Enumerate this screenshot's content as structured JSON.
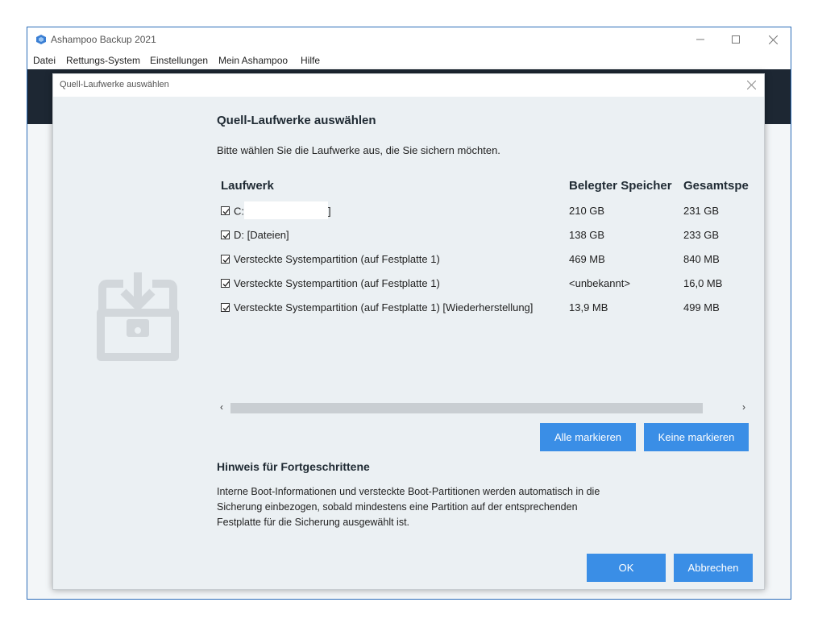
{
  "app": {
    "title": "Ashampoo Backup 2021"
  },
  "menu": [
    "Datei",
    "Rettungs-System",
    "Einstellungen",
    "Mein Ashampoo",
    "Hilfe"
  ],
  "dialog": {
    "window_title": "Quell-Laufwerke auswählen",
    "heading": "Quell-Laufwerke auswählen",
    "intro": "Bitte wählen Sie die Laufwerke aus, die Sie sichern möchten.",
    "columns": {
      "drive": "Laufwerk",
      "used": "Belegter Speicher",
      "total": "Gesamtspe"
    },
    "drives": [
      {
        "name_prefix": "C:",
        "name_suffix": "]",
        "used": "210 GB",
        "total": "231 GB",
        "checked": true
      },
      {
        "name": "D: [Dateien]",
        "used": "138 GB",
        "total": "233 GB",
        "checked": true
      },
      {
        "name": "Versteckte Systempartition (auf Festplatte 1)",
        "used": "469 MB",
        "total": "840 MB",
        "checked": true
      },
      {
        "name": "Versteckte Systempartition (auf Festplatte 1)",
        "used": "<unbekannt>",
        "total": "16,0 MB",
        "checked": true
      },
      {
        "name": "Versteckte Systempartition (auf Festplatte 1) [Wiederherstellung]",
        "used": "13,9 MB",
        "total": "499 MB",
        "checked": true
      }
    ],
    "buttons": {
      "select_all": "Alle markieren",
      "select_none": "Keine markieren",
      "ok": "OK",
      "cancel": "Abbrechen"
    },
    "hint": {
      "heading": "Hinweis für Fortgeschrittene",
      "text": "Interne Boot-Informationen und versteckte Boot-Partitionen werden automatisch in die Sicherung einbezogen, sobald mindestens eine Partition auf der entsprechenden Festplatte für die Sicherung ausgewählt ist."
    }
  },
  "colors": {
    "accent": "#3a8ee6",
    "dark_header": "#1d2733",
    "dialog_bg": "#ebf0f3"
  },
  "icons": [
    "app-logo-icon",
    "minimize-icon",
    "maximize-icon",
    "close-icon",
    "backup-chest-icon",
    "checkbox-checked-icon",
    "scroll-left-icon",
    "scroll-right-icon"
  ]
}
